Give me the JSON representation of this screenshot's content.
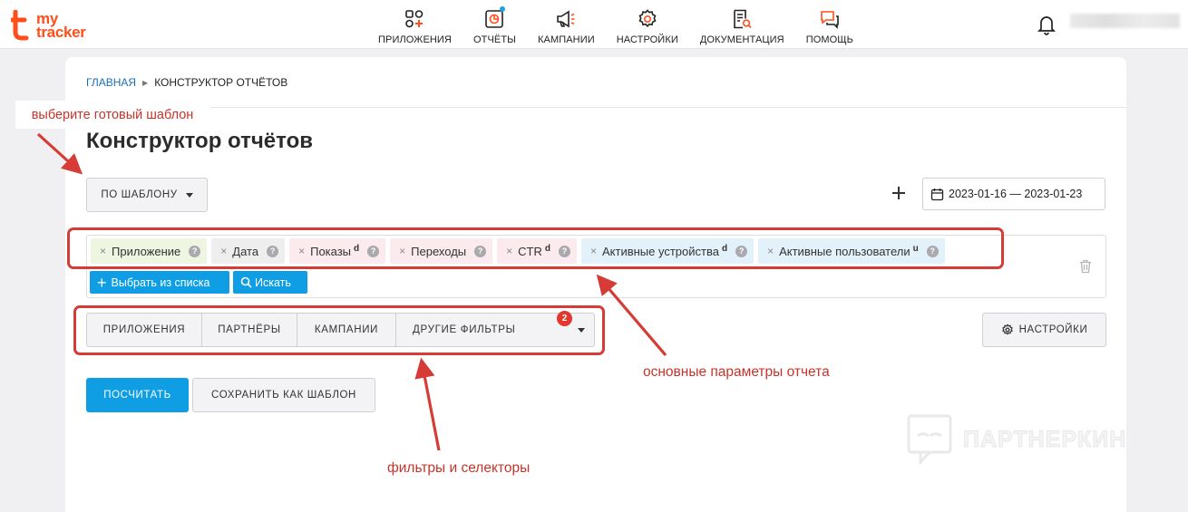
{
  "brand": {
    "line1": "my",
    "line2": "tracker",
    "color": "#ff4e1a"
  },
  "nav": {
    "items": [
      {
        "label": "ПРИЛОЖЕНИЯ",
        "icon": "apps-grid-plus-icon"
      },
      {
        "label": "ОТЧЁТЫ",
        "icon": "report-chart-icon"
      },
      {
        "label": "КАМПАНИИ",
        "icon": "megaphone-icon"
      },
      {
        "label": "НАСТРОЙКИ",
        "icon": "gear-icon"
      },
      {
        "label": "ДОКУМЕНТАЦИЯ",
        "icon": "document-search-icon"
      },
      {
        "label": "ПОМОЩЬ",
        "icon": "chat-bubbles-icon"
      }
    ]
  },
  "breadcrumb": {
    "home": "ГЛАВНАЯ",
    "current": "КОНСТРУКТОР ОТЧЁТОВ"
  },
  "page": {
    "title": "Конструктор отчётов"
  },
  "toolbar": {
    "template_button": "ПО ШАБЛОНУ",
    "date_range": "2023-01-16 — 2023-01-23"
  },
  "params": {
    "chips": [
      {
        "label": "Приложение",
        "sup": ""
      },
      {
        "label": "Дата",
        "sup": ""
      },
      {
        "label": "Показы",
        "sup": "d"
      },
      {
        "label": "Переходы",
        "sup": ""
      },
      {
        "label": "CTR",
        "sup": "d"
      },
      {
        "label": "Активные устройства",
        "sup": "d"
      },
      {
        "label": "Активные пользователи",
        "sup": "u"
      }
    ],
    "remove_glyph": "×",
    "help_glyph": "?",
    "pick_button": "Выбрать из списка",
    "search_button": "Искать"
  },
  "filters": {
    "tabs": [
      "ПРИЛОЖЕНИЯ",
      "ПАРТНЁРЫ",
      "КАМПАНИИ",
      "ДРУГИЕ ФИЛЬТРЫ"
    ],
    "badge_count": "2",
    "settings_button": "НАСТРОЙКИ"
  },
  "actions": {
    "calculate": "ПОСЧИТАТЬ",
    "save_template": "СОХРАНИТЬ КАК ШАБЛОН"
  },
  "annotations": {
    "template": "выберите готовый шаблон",
    "params": "основные параметры отчета",
    "filters": "фильтры и селекторы"
  },
  "watermark": {
    "text": "ПАРТНЕРКИН"
  },
  "colors": {
    "accent": "#0f9ee3",
    "annotation": "#d63b35",
    "badge": "#e2372e",
    "link": "#1a6fb5"
  }
}
